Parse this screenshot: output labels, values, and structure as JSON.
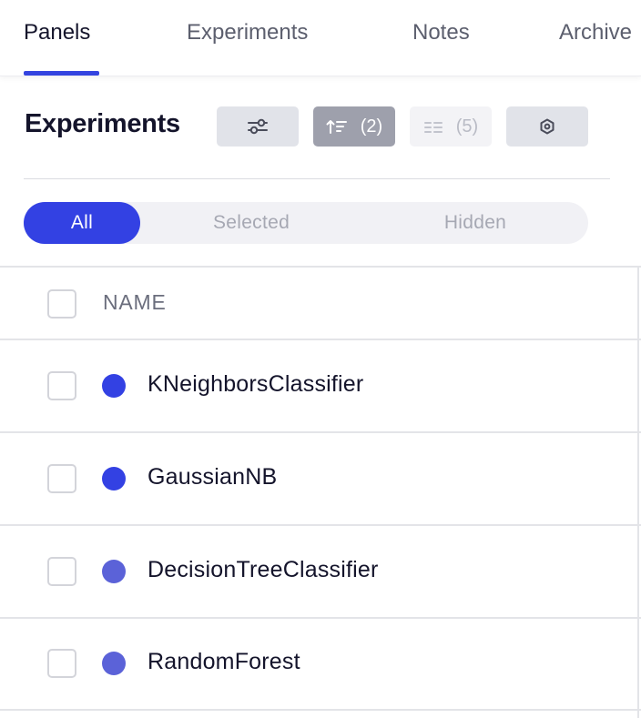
{
  "tabs": [
    {
      "label": "Panels",
      "active": true
    },
    {
      "label": "Experiments",
      "active": false
    },
    {
      "label": "Notes",
      "active": false
    },
    {
      "label": "Archive",
      "active": false
    }
  ],
  "header": {
    "title": "Experiments",
    "toolbar": {
      "filter_icon": "sliders-icon",
      "sort_icon": "sort-icon",
      "sort_count": "(2)",
      "group_icon": "group-icon",
      "group_count": "(5)",
      "settings_icon": "hexagon-settings-icon"
    }
  },
  "filter": {
    "options": [
      {
        "label": "All",
        "active": true
      },
      {
        "label": "Selected",
        "active": false
      },
      {
        "label": "Hidden",
        "active": false
      }
    ]
  },
  "table": {
    "column_header": "NAME",
    "rows": [
      {
        "name": "KNeighborsClassifier",
        "color": "#3341e3"
      },
      {
        "name": "GaussianNB",
        "color": "#3341e3"
      },
      {
        "name": "DecisionTreeClassifier",
        "color": "#5b62d8"
      },
      {
        "name": "RandomForest",
        "color": "#5b62d8"
      }
    ]
  },
  "colors": {
    "accent": "#3341e3",
    "text": "#14142b",
    "muted": "#a6a8b3"
  }
}
